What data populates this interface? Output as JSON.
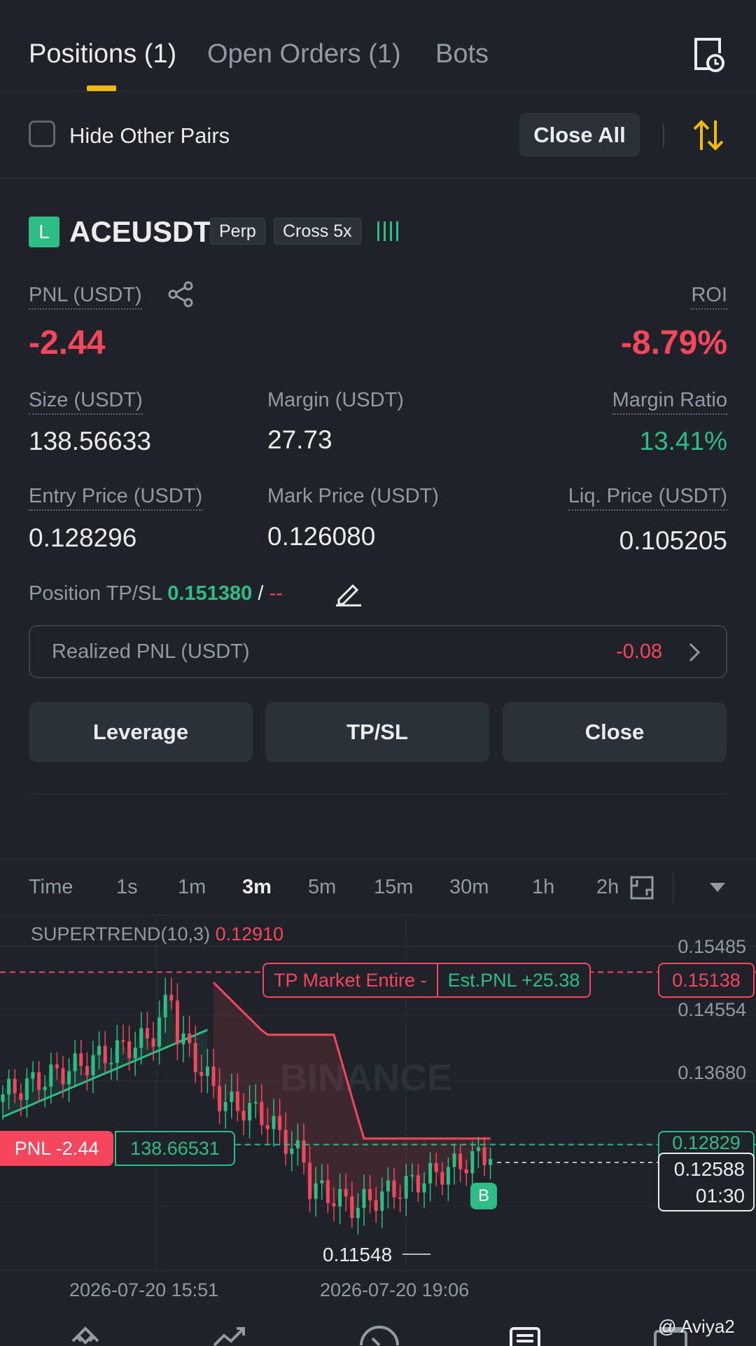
{
  "tabs": [
    {
      "label": "Positions (1)",
      "active": true
    },
    {
      "label": "Open Orders (1)",
      "active": false
    },
    {
      "label": "Bots",
      "active": false
    }
  ],
  "controls": {
    "hide_other_pairs": "Hide Other Pairs",
    "close_all": "Close All"
  },
  "position": {
    "side_badge": "L",
    "symbol": "ACEUSDT",
    "type_tag": "Perp",
    "margin_tag": "Cross 5x",
    "pnl_label": "PNL (USDT)",
    "pnl_value": "-2.44",
    "roi_label": "ROI",
    "roi_value": "-8.79%",
    "size_label": "Size (USDT)",
    "size_value": "138.56633",
    "margin_label": "Margin (USDT)",
    "margin_value": "27.73",
    "margin_ratio_label": "Margin Ratio",
    "margin_ratio_value": "13.41%",
    "entry_label": "Entry Price (USDT)",
    "entry_value": "0.128296",
    "mark_label": "Mark Price (USDT)",
    "mark_value": "0.126080",
    "liq_label": "Liq. Price (USDT)",
    "liq_value": "0.105205",
    "tpsl_label": "Position TP/SL",
    "tp_value": "0.151380",
    "tpsl_sep": "/",
    "sl_value": "--",
    "realized_label": "Realized PNL (USDT)",
    "realized_value": "-0.08",
    "btn_leverage": "Leverage",
    "btn_tpsl": "TP/SL",
    "btn_close": "Close"
  },
  "chart_toolbar": {
    "timeframes": [
      "Time",
      "1s",
      "1m",
      "3m",
      "5m",
      "15m",
      "30m",
      "1h",
      "2h"
    ],
    "active": "3m"
  },
  "chart": {
    "indicator_name": "SUPERTREND(10,3)",
    "indicator_value": "0.12910",
    "tp_line_label": "TP Market Entire -",
    "tp_est_pnl": "Est.PNL +25.38",
    "tp_price": "0.15138",
    "pnl_line_label": "PNL -2.44",
    "pnl_line_size": "138.66531",
    "entry_price": "0.12829",
    "current_price": "0.12588",
    "countdown": "01:30",
    "low_label": "0.11548",
    "buy_marker": "B",
    "watermark": "BINANCE",
    "watermark_credit": "@ Aviya2",
    "y_axis": [
      "0.15485",
      "0.14554",
      "0.13680"
    ],
    "x_axis": [
      "2026-07-20 15:51",
      "2026-07-20 19:06"
    ],
    "colors": {
      "up": "#2ebd85",
      "down": "#f6465d"
    }
  },
  "chart_data": {
    "type": "candlestick",
    "y_range": [
      0.112,
      0.158
    ],
    "y_ticks": [
      0.15485,
      0.14554,
      0.1368
    ],
    "x_ticks": [
      "2026-07-20 15:51",
      "2026-07-20 19:06"
    ],
    "tp_price": 0.15138,
    "entry_price": 0.12829,
    "current_price": 0.12588,
    "low": 0.11548,
    "supertrend": 0.1291
  },
  "bottom_nav": [
    "home-icon",
    "markets-icon",
    "trade-icon",
    "futures-icon",
    "wallet-icon"
  ]
}
